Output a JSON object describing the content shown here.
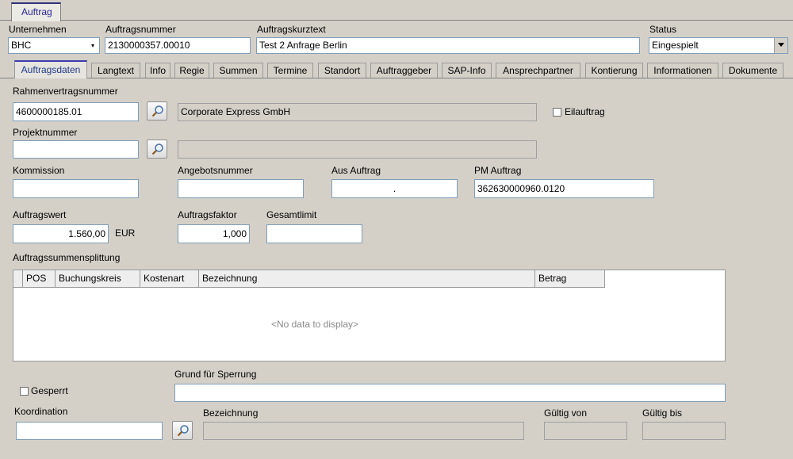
{
  "window": {
    "doc_tab": "Auftrag"
  },
  "header": {
    "unternehmen_label": "Unternehmen",
    "unternehmen_value": "BHC",
    "auftragsnummer_label": "Auftragsnummer",
    "auftragsnummer_value": "2130000357.00010",
    "kurztext_label": "Auftragskurztext",
    "kurztext_value": "Test 2 Anfrage Berlin",
    "status_label": "Status",
    "status_value": "Eingespielt"
  },
  "tabs": [
    "Auftragsdaten",
    "Langtext",
    "Info",
    "Regie",
    "Summen",
    "Termine",
    "Standort",
    "Auftraggeber",
    "SAP-Info",
    "Ansprechpartner",
    "Kontierung",
    "Informationen",
    "Dokumente"
  ],
  "form": {
    "rahmen_label": "Rahmenvertragsnummer",
    "rahmen_value": "4600000185.01",
    "rahmen_name": "Corporate Express GmbH",
    "eilauftrag_label": "Eilauftrag",
    "projekt_label": "Projektnummer",
    "projekt_value": "",
    "projekt_name": "",
    "kommission_label": "Kommission",
    "kommission_value": "",
    "angebot_label": "Angebotsnummer",
    "angebot_value": "",
    "aus_auftrag_label": "Aus Auftrag",
    "aus_auftrag_value": ".",
    "pm_auftrag_label": "PM Auftrag",
    "pm_auftrag_value": "362630000960.0120",
    "auftragswert_label": "Auftragswert",
    "auftragswert_value": "1.560,00",
    "currency": "EUR",
    "faktor_label": "Auftragsfaktor",
    "faktor_value": "1,000",
    "gesamtlimit_label": "Gesamtlimit",
    "gesamtlimit_value": "",
    "split_label": "Auftragssummensplittung",
    "grid_columns": [
      "POS",
      "Buchungskreis",
      "Kostenart",
      "Bezeichnung",
      "Betrag"
    ],
    "grid_empty": "<No data to display>",
    "gesperrt_label": "Gesperrt",
    "sperrgrund_label": "Grund für Sperrung",
    "sperrgrund_value": "",
    "koordination_label": "Koordination",
    "koordination_value": "",
    "bezeichnung_label": "Bezeichnung",
    "bezeichnung_value": "",
    "gueltig_von_label": "Gültig von",
    "gueltig_von_value": "",
    "gueltig_bis_label": "Gültig bis",
    "gueltig_bis_value": ""
  },
  "icons": {
    "lookup": "magnifier-icon",
    "dropdown": "chevron-down-icon"
  },
  "colors": {
    "background": "#d4d0c8",
    "active_tab_text": "#1f3b8a",
    "accent": "#3c3cae"
  }
}
